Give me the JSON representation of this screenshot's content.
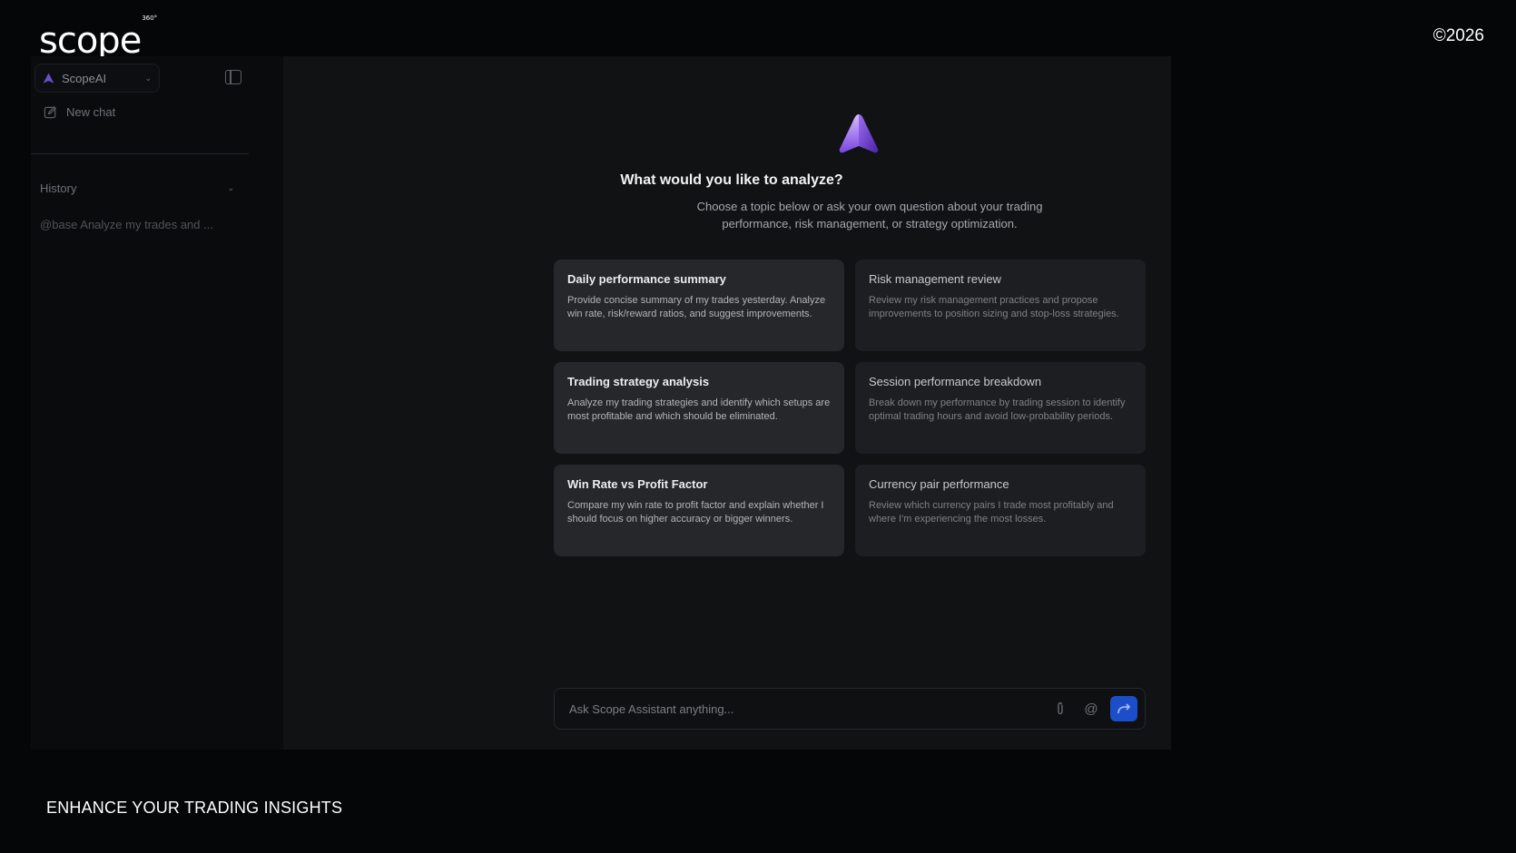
{
  "brand": {
    "name": "scope",
    "superscript": "360°",
    "copyright": "©2026",
    "tagline": "ENHANCE YOUR TRADING INSIGHTS"
  },
  "sidebar": {
    "model_selector": {
      "label": "ScopeAI"
    },
    "new_chat_label": "New chat",
    "history": {
      "heading": "History",
      "items": [
        "@base Analyze my trades and ..."
      ]
    }
  },
  "hero": {
    "title": "What would you like to analyze?",
    "subtitle": "Choose a topic below or ask your own question about your trading performance, risk management, or strategy optimization."
  },
  "cards": [
    {
      "title": "Daily performance summary",
      "desc": "Provide concise summary of my trades yesterday. Analyze win rate, risk/reward ratios, and suggest improvements."
    },
    {
      "title": "Risk management review",
      "desc": "Review my risk management practices and propose improvements to position sizing and stop-loss strategies."
    },
    {
      "title": "Trading strategy analysis",
      "desc": "Analyze my trading strategies and identify which setups are most profitable and which should be eliminated."
    },
    {
      "title": "Session performance breakdown",
      "desc": "Break down my performance by trading session to identify optimal trading hours and avoid low-probability periods."
    },
    {
      "title": "Win Rate vs Profit Factor",
      "desc": "Compare my win rate to profit factor and explain whether I should focus on higher accuracy or bigger winners."
    },
    {
      "title": "Currency pair performance",
      "desc": "Review which currency pairs I trade most profitably and where I'm experiencing the most losses."
    }
  ],
  "composer": {
    "placeholder": "Ask Scope Assistant anything..."
  },
  "colors": {
    "accent": "#1c4ec9",
    "logo_gradient_start": "#c9a8ff",
    "logo_gradient_end": "#6c3ed6"
  }
}
